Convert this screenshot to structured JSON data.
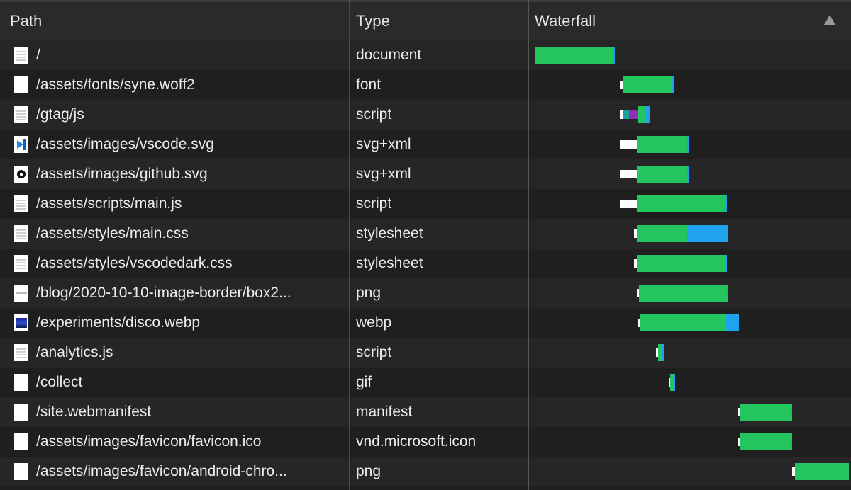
{
  "header": {
    "path_label": "Path",
    "type_label": "Type",
    "waterfall_label": "Waterfall",
    "sort_icon": "sort-ascending-triangle"
  },
  "colors": {
    "waiting": "#ffffff",
    "download": "#22c55e",
    "receive": "#1fa3ee",
    "dns": "#1aa39a",
    "ssl": "#8e2fb5"
  },
  "rows": [
    {
      "icon": "document-icon",
      "path": "/",
      "type": "document",
      "timing": [
        {
          "k": "green",
          "s": 0,
          "e": 0.245
        },
        {
          "k": "blue",
          "s": 0.245,
          "e": 0.252
        }
      ]
    },
    {
      "icon": "blank-file-icon",
      "path": "/assets/fonts/syne.woff2",
      "type": "font",
      "timing": [
        {
          "k": "white",
          "s": 0.268,
          "e": 0.277
        },
        {
          "k": "green",
          "s": 0.277,
          "e": 0.435
        },
        {
          "k": "blue",
          "s": 0.435,
          "e": 0.443
        }
      ]
    },
    {
      "icon": "document-icon",
      "path": "/gtag/js",
      "type": "script",
      "timing": [
        {
          "k": "white",
          "s": 0.268,
          "e": 0.28
        },
        {
          "k": "teal",
          "s": 0.28,
          "e": 0.297
        },
        {
          "k": "purple",
          "s": 0.297,
          "e": 0.327
        },
        {
          "k": "green",
          "s": 0.327,
          "e": 0.348
        },
        {
          "k": "blue",
          "s": 0.348,
          "e": 0.365
        }
      ]
    },
    {
      "icon": "vscode-icon",
      "path": "/assets/images/vscode.svg",
      "type": "svg+xml",
      "timing": [
        {
          "k": "white",
          "s": 0.268,
          "e": 0.322
        },
        {
          "k": "green",
          "s": 0.322,
          "e": 0.483
        },
        {
          "k": "blue",
          "s": 0.483,
          "e": 0.488
        }
      ]
    },
    {
      "icon": "github-icon",
      "path": "/assets/images/github.svg",
      "type": "svg+xml",
      "timing": [
        {
          "k": "white",
          "s": 0.268,
          "e": 0.322
        },
        {
          "k": "green",
          "s": 0.322,
          "e": 0.483
        },
        {
          "k": "blue",
          "s": 0.483,
          "e": 0.488
        }
      ]
    },
    {
      "icon": "document-icon",
      "path": "/assets/scripts/main.js",
      "type": "script",
      "timing": [
        {
          "k": "white",
          "s": 0.268,
          "e": 0.322
        },
        {
          "k": "green",
          "s": 0.322,
          "e": 0.605
        },
        {
          "k": "blue",
          "s": 0.605,
          "e": 0.61
        }
      ]
    },
    {
      "icon": "document-icon",
      "path": "/assets/styles/main.css",
      "type": "stylesheet",
      "timing": [
        {
          "k": "white",
          "s": 0.313,
          "e": 0.322
        },
        {
          "k": "green",
          "s": 0.322,
          "e": 0.483
        },
        {
          "k": "blue",
          "s": 0.483,
          "e": 0.611
        }
      ]
    },
    {
      "icon": "document-icon",
      "path": "/assets/styles/vscodedark.css",
      "type": "stylesheet",
      "timing": [
        {
          "k": "white",
          "s": 0.313,
          "e": 0.322
        },
        {
          "k": "green",
          "s": 0.322,
          "e": 0.605
        },
        {
          "k": "blue",
          "s": 0.605,
          "e": 0.61
        }
      ]
    },
    {
      "icon": "image-line-icon",
      "path": "/blog/2020-10-10-image-border/box2...",
      "type": "png",
      "timing": [
        {
          "k": "white",
          "s": 0.322,
          "e": 0.33
        },
        {
          "k": "green",
          "s": 0.33,
          "e": 0.61
        },
        {
          "k": "blue",
          "s": 0.61,
          "e": 0.615
        }
      ]
    },
    {
      "icon": "webp-thumbnail-icon",
      "path": "/experiments/disco.webp",
      "type": "webp",
      "timing": [
        {
          "k": "white",
          "s": 0.327,
          "e": 0.335
        },
        {
          "k": "green",
          "s": 0.335,
          "e": 0.607
        },
        {
          "k": "blue",
          "s": 0.607,
          "e": 0.648
        }
      ]
    },
    {
      "icon": "document-icon",
      "path": "/analytics.js",
      "type": "script",
      "timing": [
        {
          "k": "white",
          "s": 0.383,
          "e": 0.39
        },
        {
          "k": "green",
          "s": 0.39,
          "e": 0.402
        },
        {
          "k": "blue",
          "s": 0.402,
          "e": 0.408
        }
      ]
    },
    {
      "icon": "blank-file-icon",
      "path": "/collect",
      "type": "gif",
      "timing": [
        {
          "k": "white",
          "s": 0.425,
          "e": 0.43
        },
        {
          "k": "green",
          "s": 0.43,
          "e": 0.44
        },
        {
          "k": "blue",
          "s": 0.44,
          "e": 0.443
        }
      ]
    },
    {
      "icon": "blank-file-icon",
      "path": "/site.webmanifest",
      "type": "manifest",
      "timing": [
        {
          "k": "white",
          "s": 0.645,
          "e": 0.653
        },
        {
          "k": "green",
          "s": 0.653,
          "e": 0.812
        },
        {
          "k": "blue",
          "s": 0.812,
          "e": 0.817
        }
      ]
    },
    {
      "icon": "blank-file-icon",
      "path": "/assets/images/favicon/favicon.ico",
      "type": "vnd.microsoft.icon",
      "timing": [
        {
          "k": "white",
          "s": 0.645,
          "e": 0.653
        },
        {
          "k": "green",
          "s": 0.653,
          "e": 0.812
        },
        {
          "k": "blue",
          "s": 0.812,
          "e": 0.817
        }
      ]
    },
    {
      "icon": "blank-file-icon",
      "path": "/assets/images/favicon/android-chro...",
      "type": "png",
      "timing": [
        {
          "k": "white",
          "s": 0.818,
          "e": 0.826
        },
        {
          "k": "green",
          "s": 0.826,
          "e": 0.998
        }
      ]
    }
  ]
}
